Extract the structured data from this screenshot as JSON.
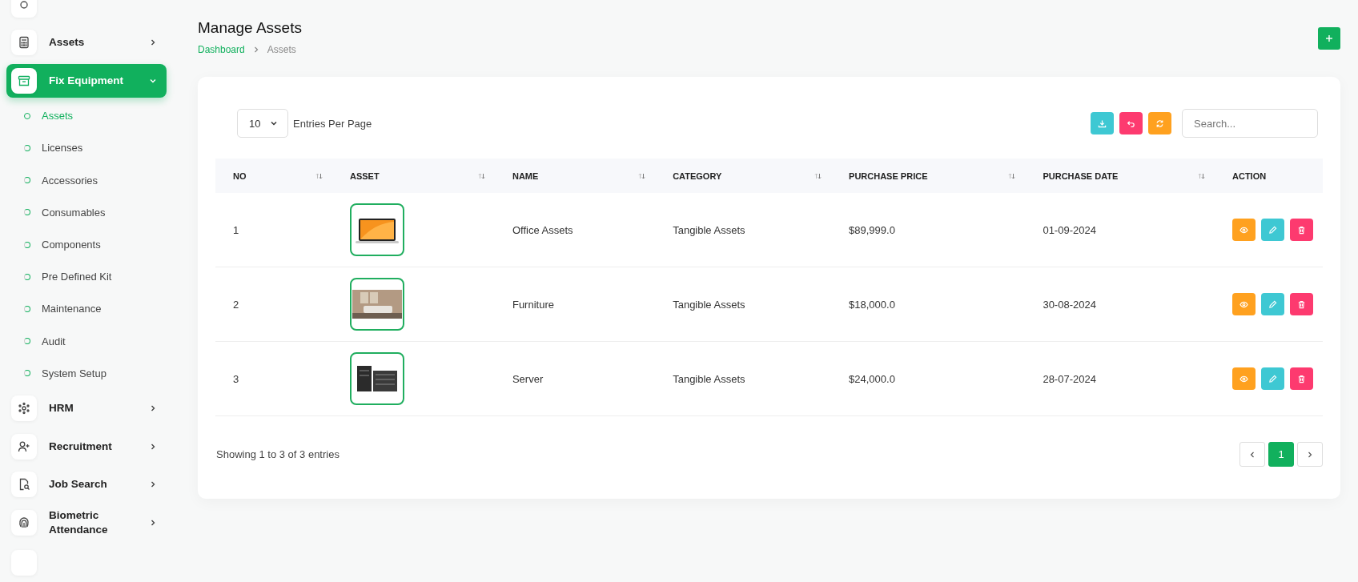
{
  "sidebar": {
    "items": [
      {
        "label": "Assets",
        "expanded": false,
        "selected": false
      },
      {
        "label": "Fix Equipment",
        "expanded": true,
        "selected": true,
        "children": [
          {
            "label": "Assets",
            "selected": true
          },
          {
            "label": "Licenses",
            "selected": false
          },
          {
            "label": "Accessories",
            "selected": false
          },
          {
            "label": "Consumables",
            "selected": false
          },
          {
            "label": "Components",
            "selected": false
          },
          {
            "label": "Pre Defined Kit",
            "selected": false
          },
          {
            "label": "Maintenance",
            "selected": false
          },
          {
            "label": "Audit",
            "selected": false
          },
          {
            "label": "System Setup",
            "selected": false
          }
        ]
      },
      {
        "label": "HRM",
        "expanded": false,
        "selected": false
      },
      {
        "label": "Recruitment",
        "expanded": false,
        "selected": false
      },
      {
        "label": "Job Search",
        "expanded": false,
        "selected": false
      },
      {
        "label": "Biometric Attendance",
        "expanded": false,
        "selected": false
      }
    ]
  },
  "header": {
    "title": "Manage Assets",
    "breadcrumb": [
      "Dashboard",
      "Assets"
    ]
  },
  "toolbar": {
    "entries": {
      "value": "10",
      "label": "Entries Per Page"
    },
    "buttons": [
      {
        "kind": "download"
      },
      {
        "kind": "undo"
      },
      {
        "kind": "refresh"
      }
    ],
    "search": {
      "placeholder": "Search..."
    }
  },
  "table": {
    "columns": [
      "NO",
      "ASSET",
      "NAME",
      "CATEGORY",
      "PURCHASE PRICE",
      "PURCHASE DATE",
      "ACTION"
    ],
    "rows": [
      {
        "no": "1",
        "name": "Office Assets",
        "category": "Tangible Assets",
        "price": "$89,999.0",
        "date": "01-09-2024"
      },
      {
        "no": "2",
        "name": "Furniture",
        "category": "Tangible Assets",
        "price": "$18,000.0",
        "date": "30-08-2024"
      },
      {
        "no": "3",
        "name": "Server",
        "category": "Tangible Assets",
        "price": "$24,000.0",
        "date": "28-07-2024"
      }
    ]
  },
  "footer": {
    "summary": "Showing 1 to 3 of 3 entries",
    "pages": [
      {
        "label": "1",
        "selected": true
      }
    ]
  }
}
